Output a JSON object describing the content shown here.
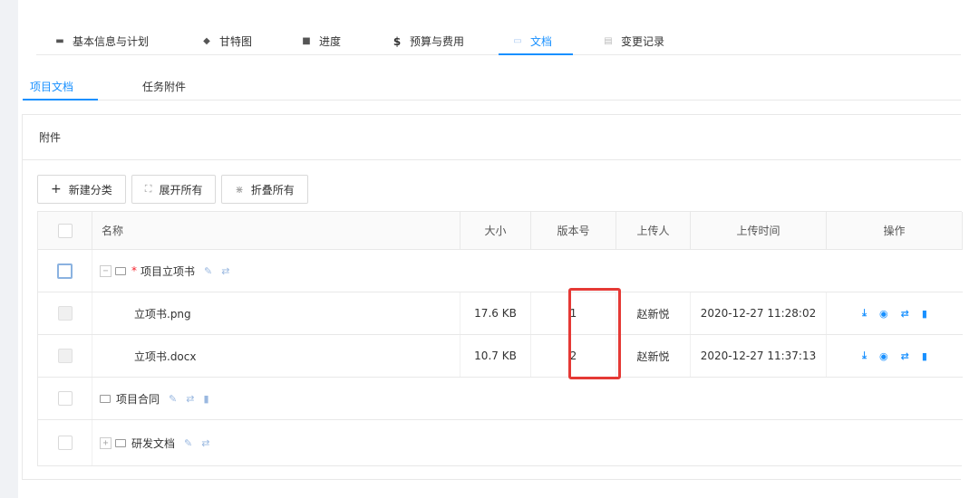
{
  "top_tabs": [
    {
      "label": "基本信息与计划",
      "icon": "list-icon",
      "glyph": "▬"
    },
    {
      "label": "甘特图",
      "icon": "layers-icon",
      "glyph": "◆"
    },
    {
      "label": "进度",
      "icon": "square-icon",
      "glyph": "■"
    },
    {
      "label": "预算与费用",
      "icon": "dollar-icon",
      "glyph": "$"
    },
    {
      "label": "文档",
      "icon": "folder-icon",
      "glyph": "▭"
    },
    {
      "label": "变更记录",
      "icon": "log-icon",
      "glyph": "▤"
    }
  ],
  "sub_tabs": [
    {
      "label": "项目文档"
    },
    {
      "label": "任务附件"
    }
  ],
  "card": {
    "title": "附件"
  },
  "toolbar": {
    "new_category": "新建分类",
    "expand_all": "展开所有",
    "collapse_all": "折叠所有"
  },
  "table": {
    "headers": {
      "name": "名称",
      "size": "大小",
      "version": "版本号",
      "uploader": "上传人",
      "upload_time": "上传时间",
      "actions": "操作"
    },
    "rows": [
      {
        "type": "folder",
        "name": "项目立项书",
        "required": "*",
        "expanded": true
      },
      {
        "type": "file",
        "name": "立项书.png",
        "size": "17.6 KB",
        "version": "1",
        "uploader": "赵新悦",
        "upload_time": "2020-12-27 11:28:02"
      },
      {
        "type": "file",
        "name": "立项书.docx",
        "size": "10.7 KB",
        "version": "2",
        "uploader": "赵新悦",
        "upload_time": "2020-12-27 11:37:13"
      },
      {
        "type": "folder",
        "name": "项目合同"
      },
      {
        "type": "folder",
        "name": "研发文档",
        "expanded": false
      }
    ]
  },
  "colors": {
    "accent": "#1890ff",
    "highlight": "#e53935",
    "required": "#f5222d"
  }
}
